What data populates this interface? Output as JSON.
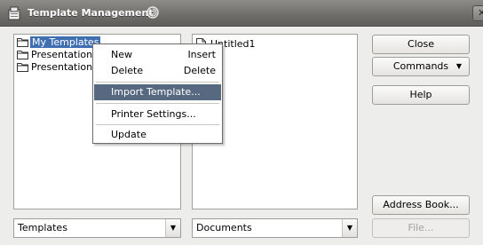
{
  "window": {
    "title": "Template Management"
  },
  "templates_tree": {
    "items": [
      {
        "label": "My Templates",
        "selected": true
      },
      {
        "label": "Presentation"
      },
      {
        "label": "Presentation"
      }
    ]
  },
  "documents_list": {
    "items": [
      {
        "label": "Untitled1"
      }
    ]
  },
  "context_menu": {
    "new": {
      "label": "New",
      "shortcut": "Insert"
    },
    "delete": {
      "label": "Delete",
      "shortcut": "Delete"
    },
    "import_template": {
      "label": "Import Template..."
    },
    "printer_settings": {
      "label": "Printer Settings..."
    },
    "update": {
      "label": "Update"
    }
  },
  "buttons": {
    "close": "Close",
    "commands": "Commands",
    "help": "Help",
    "address_book": "Address Book...",
    "file": "File..."
  },
  "combos": {
    "left_value": "Templates",
    "right_value": "Documents"
  },
  "colors": {
    "titlebar": "#6e6d69",
    "selection": "#3f6fb0",
    "menu_highlight": "#576981"
  }
}
